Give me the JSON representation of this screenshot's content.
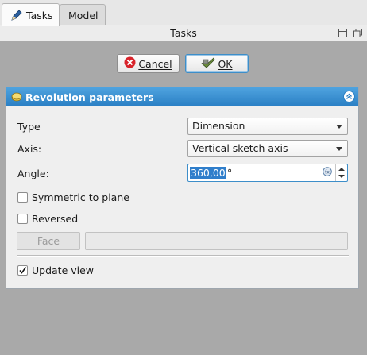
{
  "tabs": [
    {
      "label": "Tasks",
      "icon": "pencil-icon",
      "active": true
    },
    {
      "label": "Model",
      "active": false
    }
  ],
  "panel": {
    "title": "Tasks"
  },
  "actions": {
    "cancel_label": "Cancel",
    "ok_label": "OK"
  },
  "group": {
    "title": "Revolution parameters",
    "type_label": "Type",
    "type_value": "Dimension",
    "axis_label": "Axis:",
    "axis_value": "Vertical sketch axis",
    "angle_label": "Angle:",
    "angle_value": "360,00",
    "angle_unit": "°",
    "symmetric_label": "Symmetric to plane",
    "symmetric_checked": false,
    "reversed_label": "Reversed",
    "reversed_checked": false,
    "face_button_label": "Face",
    "face_value": "",
    "update_view_label": "Update view",
    "update_view_checked": true
  },
  "colors": {
    "header_blue": "#2a7fc4",
    "selection_blue": "#2f7ecb",
    "background": "#a9a9a9"
  }
}
